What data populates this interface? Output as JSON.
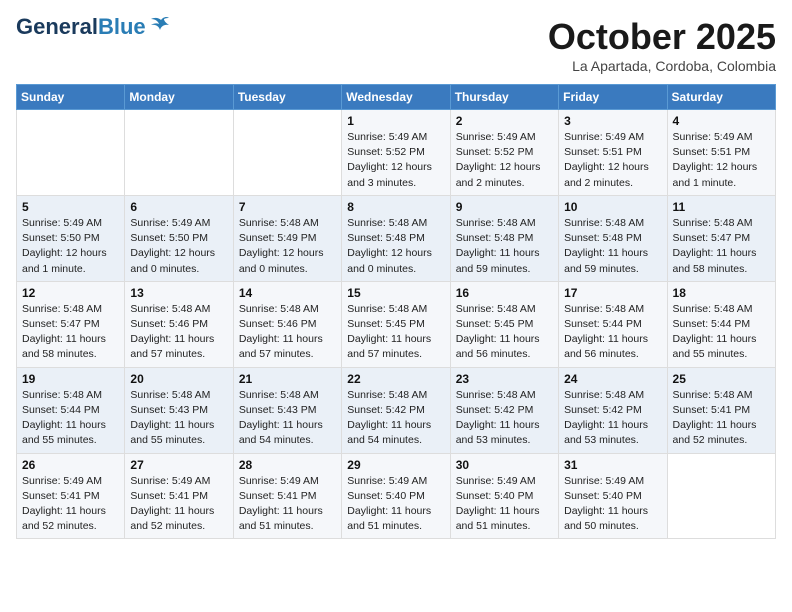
{
  "header": {
    "logo_general": "General",
    "logo_blue": "Blue",
    "month": "October 2025",
    "location": "La Apartada, Cordoba, Colombia"
  },
  "weekdays": [
    "Sunday",
    "Monday",
    "Tuesday",
    "Wednesday",
    "Thursday",
    "Friday",
    "Saturday"
  ],
  "weeks": [
    [
      {
        "day": "",
        "info": ""
      },
      {
        "day": "",
        "info": ""
      },
      {
        "day": "",
        "info": ""
      },
      {
        "day": "1",
        "info": "Sunrise: 5:49 AM\nSunset: 5:52 PM\nDaylight: 12 hours and 3 minutes."
      },
      {
        "day": "2",
        "info": "Sunrise: 5:49 AM\nSunset: 5:52 PM\nDaylight: 12 hours and 2 minutes."
      },
      {
        "day": "3",
        "info": "Sunrise: 5:49 AM\nSunset: 5:51 PM\nDaylight: 12 hours and 2 minutes."
      },
      {
        "day": "4",
        "info": "Sunrise: 5:49 AM\nSunset: 5:51 PM\nDaylight: 12 hours and 1 minute."
      }
    ],
    [
      {
        "day": "5",
        "info": "Sunrise: 5:49 AM\nSunset: 5:50 PM\nDaylight: 12 hours and 1 minute."
      },
      {
        "day": "6",
        "info": "Sunrise: 5:49 AM\nSunset: 5:50 PM\nDaylight: 12 hours and 0 minutes."
      },
      {
        "day": "7",
        "info": "Sunrise: 5:48 AM\nSunset: 5:49 PM\nDaylight: 12 hours and 0 minutes."
      },
      {
        "day": "8",
        "info": "Sunrise: 5:48 AM\nSunset: 5:48 PM\nDaylight: 12 hours and 0 minutes."
      },
      {
        "day": "9",
        "info": "Sunrise: 5:48 AM\nSunset: 5:48 PM\nDaylight: 11 hours and 59 minutes."
      },
      {
        "day": "10",
        "info": "Sunrise: 5:48 AM\nSunset: 5:48 PM\nDaylight: 11 hours and 59 minutes."
      },
      {
        "day": "11",
        "info": "Sunrise: 5:48 AM\nSunset: 5:47 PM\nDaylight: 11 hours and 58 minutes."
      }
    ],
    [
      {
        "day": "12",
        "info": "Sunrise: 5:48 AM\nSunset: 5:47 PM\nDaylight: 11 hours and 58 minutes."
      },
      {
        "day": "13",
        "info": "Sunrise: 5:48 AM\nSunset: 5:46 PM\nDaylight: 11 hours and 57 minutes."
      },
      {
        "day": "14",
        "info": "Sunrise: 5:48 AM\nSunset: 5:46 PM\nDaylight: 11 hours and 57 minutes."
      },
      {
        "day": "15",
        "info": "Sunrise: 5:48 AM\nSunset: 5:45 PM\nDaylight: 11 hours and 57 minutes."
      },
      {
        "day": "16",
        "info": "Sunrise: 5:48 AM\nSunset: 5:45 PM\nDaylight: 11 hours and 56 minutes."
      },
      {
        "day": "17",
        "info": "Sunrise: 5:48 AM\nSunset: 5:44 PM\nDaylight: 11 hours and 56 minutes."
      },
      {
        "day": "18",
        "info": "Sunrise: 5:48 AM\nSunset: 5:44 PM\nDaylight: 11 hours and 55 minutes."
      }
    ],
    [
      {
        "day": "19",
        "info": "Sunrise: 5:48 AM\nSunset: 5:44 PM\nDaylight: 11 hours and 55 minutes."
      },
      {
        "day": "20",
        "info": "Sunrise: 5:48 AM\nSunset: 5:43 PM\nDaylight: 11 hours and 55 minutes."
      },
      {
        "day": "21",
        "info": "Sunrise: 5:48 AM\nSunset: 5:43 PM\nDaylight: 11 hours and 54 minutes."
      },
      {
        "day": "22",
        "info": "Sunrise: 5:48 AM\nSunset: 5:42 PM\nDaylight: 11 hours and 54 minutes."
      },
      {
        "day": "23",
        "info": "Sunrise: 5:48 AM\nSunset: 5:42 PM\nDaylight: 11 hours and 53 minutes."
      },
      {
        "day": "24",
        "info": "Sunrise: 5:48 AM\nSunset: 5:42 PM\nDaylight: 11 hours and 53 minutes."
      },
      {
        "day": "25",
        "info": "Sunrise: 5:48 AM\nSunset: 5:41 PM\nDaylight: 11 hours and 52 minutes."
      }
    ],
    [
      {
        "day": "26",
        "info": "Sunrise: 5:49 AM\nSunset: 5:41 PM\nDaylight: 11 hours and 52 minutes."
      },
      {
        "day": "27",
        "info": "Sunrise: 5:49 AM\nSunset: 5:41 PM\nDaylight: 11 hours and 52 minutes."
      },
      {
        "day": "28",
        "info": "Sunrise: 5:49 AM\nSunset: 5:41 PM\nDaylight: 11 hours and 51 minutes."
      },
      {
        "day": "29",
        "info": "Sunrise: 5:49 AM\nSunset: 5:40 PM\nDaylight: 11 hours and 51 minutes."
      },
      {
        "day": "30",
        "info": "Sunrise: 5:49 AM\nSunset: 5:40 PM\nDaylight: 11 hours and 51 minutes."
      },
      {
        "day": "31",
        "info": "Sunrise: 5:49 AM\nSunset: 5:40 PM\nDaylight: 11 hours and 50 minutes."
      },
      {
        "day": "",
        "info": ""
      }
    ]
  ]
}
